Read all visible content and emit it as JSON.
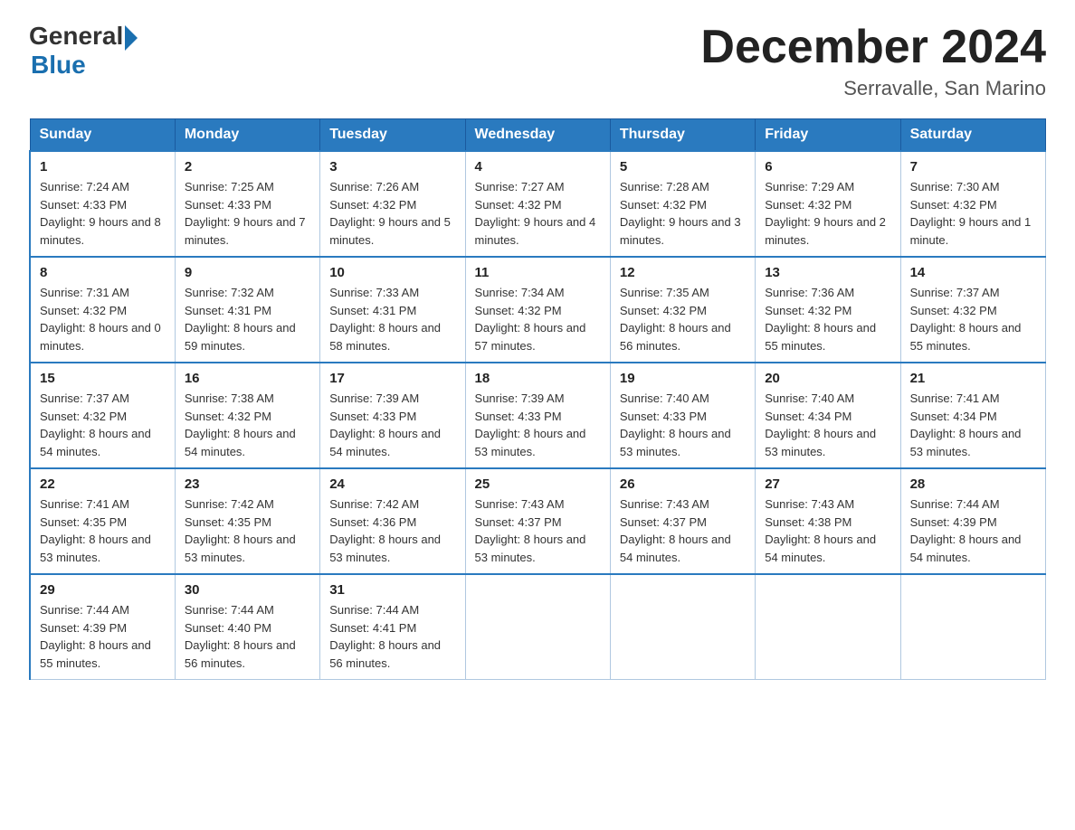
{
  "logo": {
    "general": "General",
    "blue": "Blue"
  },
  "title": {
    "month_year": "December 2024",
    "location": "Serravalle, San Marino"
  },
  "days_of_week": [
    "Sunday",
    "Monday",
    "Tuesday",
    "Wednesday",
    "Thursday",
    "Friday",
    "Saturday"
  ],
  "weeks": [
    [
      {
        "day": "1",
        "sunrise": "7:24 AM",
        "sunset": "4:33 PM",
        "daylight": "9 hours and 8 minutes."
      },
      {
        "day": "2",
        "sunrise": "7:25 AM",
        "sunset": "4:33 PM",
        "daylight": "9 hours and 7 minutes."
      },
      {
        "day": "3",
        "sunrise": "7:26 AM",
        "sunset": "4:32 PM",
        "daylight": "9 hours and 5 minutes."
      },
      {
        "day": "4",
        "sunrise": "7:27 AM",
        "sunset": "4:32 PM",
        "daylight": "9 hours and 4 minutes."
      },
      {
        "day": "5",
        "sunrise": "7:28 AM",
        "sunset": "4:32 PM",
        "daylight": "9 hours and 3 minutes."
      },
      {
        "day": "6",
        "sunrise": "7:29 AM",
        "sunset": "4:32 PM",
        "daylight": "9 hours and 2 minutes."
      },
      {
        "day": "7",
        "sunrise": "7:30 AM",
        "sunset": "4:32 PM",
        "daylight": "9 hours and 1 minute."
      }
    ],
    [
      {
        "day": "8",
        "sunrise": "7:31 AM",
        "sunset": "4:32 PM",
        "daylight": "8 hours and 0 minutes."
      },
      {
        "day": "9",
        "sunrise": "7:32 AM",
        "sunset": "4:31 PM",
        "daylight": "8 hours and 59 minutes."
      },
      {
        "day": "10",
        "sunrise": "7:33 AM",
        "sunset": "4:31 PM",
        "daylight": "8 hours and 58 minutes."
      },
      {
        "day": "11",
        "sunrise": "7:34 AM",
        "sunset": "4:32 PM",
        "daylight": "8 hours and 57 minutes."
      },
      {
        "day": "12",
        "sunrise": "7:35 AM",
        "sunset": "4:32 PM",
        "daylight": "8 hours and 56 minutes."
      },
      {
        "day": "13",
        "sunrise": "7:36 AM",
        "sunset": "4:32 PM",
        "daylight": "8 hours and 55 minutes."
      },
      {
        "day": "14",
        "sunrise": "7:37 AM",
        "sunset": "4:32 PM",
        "daylight": "8 hours and 55 minutes."
      }
    ],
    [
      {
        "day": "15",
        "sunrise": "7:37 AM",
        "sunset": "4:32 PM",
        "daylight": "8 hours and 54 minutes."
      },
      {
        "day": "16",
        "sunrise": "7:38 AM",
        "sunset": "4:32 PM",
        "daylight": "8 hours and 54 minutes."
      },
      {
        "day": "17",
        "sunrise": "7:39 AM",
        "sunset": "4:33 PM",
        "daylight": "8 hours and 54 minutes."
      },
      {
        "day": "18",
        "sunrise": "7:39 AM",
        "sunset": "4:33 PM",
        "daylight": "8 hours and 53 minutes."
      },
      {
        "day": "19",
        "sunrise": "7:40 AM",
        "sunset": "4:33 PM",
        "daylight": "8 hours and 53 minutes."
      },
      {
        "day": "20",
        "sunrise": "7:40 AM",
        "sunset": "4:34 PM",
        "daylight": "8 hours and 53 minutes."
      },
      {
        "day": "21",
        "sunrise": "7:41 AM",
        "sunset": "4:34 PM",
        "daylight": "8 hours and 53 minutes."
      }
    ],
    [
      {
        "day": "22",
        "sunrise": "7:41 AM",
        "sunset": "4:35 PM",
        "daylight": "8 hours and 53 minutes."
      },
      {
        "day": "23",
        "sunrise": "7:42 AM",
        "sunset": "4:35 PM",
        "daylight": "8 hours and 53 minutes."
      },
      {
        "day": "24",
        "sunrise": "7:42 AM",
        "sunset": "4:36 PM",
        "daylight": "8 hours and 53 minutes."
      },
      {
        "day": "25",
        "sunrise": "7:43 AM",
        "sunset": "4:37 PM",
        "daylight": "8 hours and 53 minutes."
      },
      {
        "day": "26",
        "sunrise": "7:43 AM",
        "sunset": "4:37 PM",
        "daylight": "8 hours and 54 minutes."
      },
      {
        "day": "27",
        "sunrise": "7:43 AM",
        "sunset": "4:38 PM",
        "daylight": "8 hours and 54 minutes."
      },
      {
        "day": "28",
        "sunrise": "7:44 AM",
        "sunset": "4:39 PM",
        "daylight": "8 hours and 54 minutes."
      }
    ],
    [
      {
        "day": "29",
        "sunrise": "7:44 AM",
        "sunset": "4:39 PM",
        "daylight": "8 hours and 55 minutes."
      },
      {
        "day": "30",
        "sunrise": "7:44 AM",
        "sunset": "4:40 PM",
        "daylight": "8 hours and 56 minutes."
      },
      {
        "day": "31",
        "sunrise": "7:44 AM",
        "sunset": "4:41 PM",
        "daylight": "8 hours and 56 minutes."
      },
      null,
      null,
      null,
      null
    ]
  ]
}
